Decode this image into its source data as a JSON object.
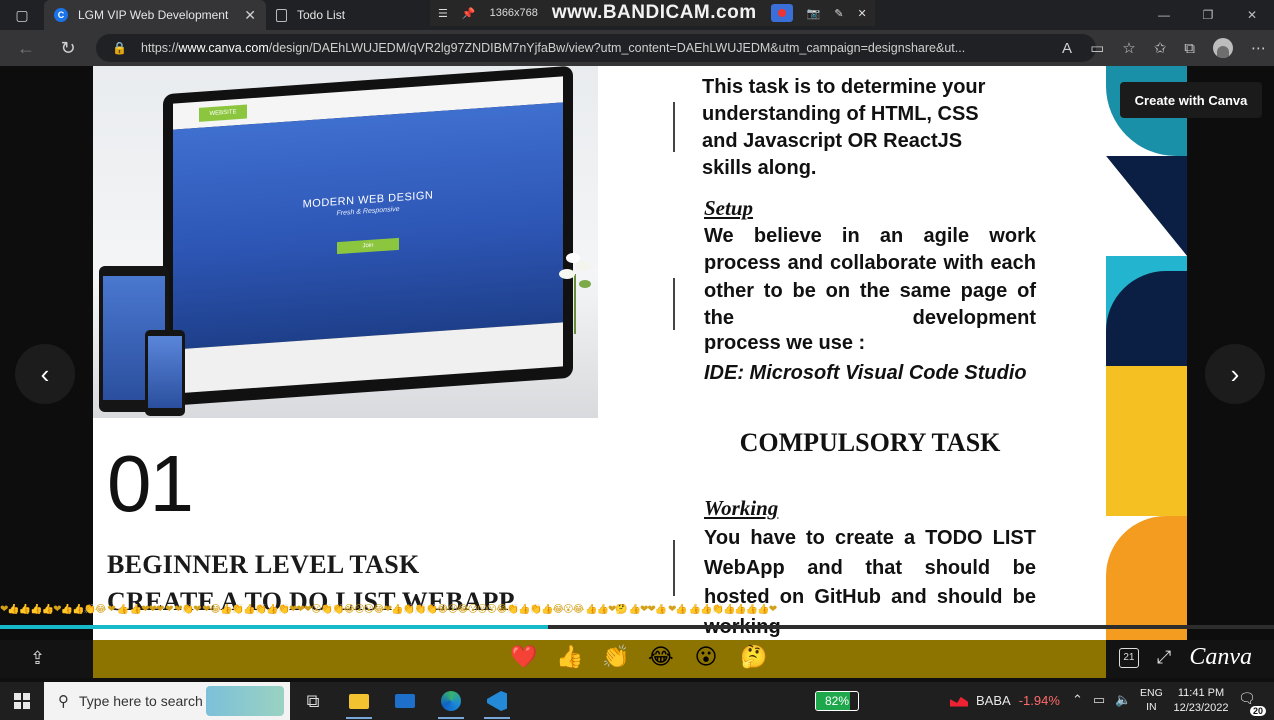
{
  "browser": {
    "tabs": [
      {
        "title": "LGM VIP Web Development",
        "active": true
      },
      {
        "title": "Todo List",
        "active": false
      }
    ],
    "url_prefix": "https://",
    "url_host": "www.canva.com",
    "url_path": "/design/DAEhLWUJEDM/qVR2lg97ZNDIBM7nYjfaBw/view?utm_content=DAEhLWUJEDM&utm_campaign=designshare&ut..."
  },
  "recorder": {
    "resolution": "1366x768",
    "brand": "www.BANDICAM.com"
  },
  "viewer": {
    "create_button": "Create with Canva",
    "progress_fraction": 0.43,
    "emoji_strip": "❤👍👍👍👍❤👍👍👏😂 ❤ 👍 👍❤❤❤ ❤ ❤👏❤ ❤😂👍👏👍👏👍👏❤❤❤😮👏👏😂😮😮😂❤👍👏👏👏😂😮😂😮😮😮😂👏👍👏👍😂😮😂 👍👍❤🤔 👍❤❤👍 ❤👍       👍👍👏👍👍👍👍❤",
    "reactions": [
      "❤️",
      "👍",
      "👏",
      "😂",
      "😮",
      "🤔"
    ],
    "page_number": "21",
    "brand": "Canva"
  },
  "slide": {
    "image": {
      "tag": "WEBSITE",
      "title": "MODERN WEB DESIGN",
      "subtitle": "Fresh & Responsive",
      "button": "Join"
    },
    "number": "01",
    "heading1": "BEGINNER LEVEL TASK",
    "heading2": "CREATE A TO DO LIST WEBAPP",
    "intro": "This task is to determine your understanding of HTML, CSS and Javascript OR ReactJS skills along.",
    "setup_heading": "Setup",
    "setup_body": "We believe in an agile work process and collaborate with each other to be on the same page of the development",
    "setup_last": "process we use :",
    "ide": "IDE: Microsoft Visual Code Studio",
    "compulsory": "COMPULSORY TASK",
    "working_heading": "Working",
    "working_body": "You have to create a TODO LIST WebApp and that should be hosted on GitHub and should be working"
  },
  "taskbar": {
    "search_placeholder": "Type here to search",
    "battery": "82%",
    "battery_fraction": 0.82,
    "stock_name": "BABA",
    "stock_change": "-1.94%",
    "lang1": "ENG",
    "lang2": "IN",
    "time": "11:41 PM",
    "date": "12/23/2022",
    "notifications": "20"
  },
  "colors": {
    "accent_green": "#8cc63f",
    "progress": "#17b8c9",
    "canva_controls": "#8d7300"
  }
}
